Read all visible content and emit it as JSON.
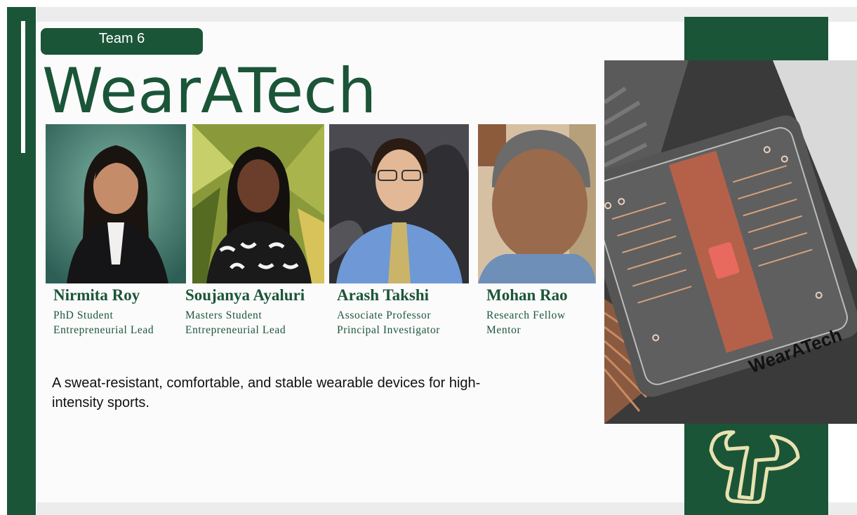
{
  "slide": {
    "team_label": "Team 6",
    "title": "WearATech",
    "description": "A sweat-resistant, comfortable, and stable wearable devices for high-intensity sports."
  },
  "members": [
    {
      "name": "Nirmita Roy",
      "role1": "PhD Student",
      "role2": "Entrepreneurial Lead"
    },
    {
      "name": "Soujanya Ayaluri",
      "role1": "Masters Student",
      "role2": "Entrepreneurial Lead"
    },
    {
      "name": "Arash Takshi",
      "role1": "Associate Professor",
      "role2": "Principal Investigator"
    },
    {
      "name": "Mohan Rao",
      "role1": "Research Fellow",
      "role2": "Mentor"
    }
  ],
  "product_image": {
    "label": "WearATech"
  },
  "colors": {
    "brand_green": "#1b5538",
    "logo_gold": "#e8e2b0"
  },
  "icons": {
    "logo": "bull-horns-logo"
  }
}
